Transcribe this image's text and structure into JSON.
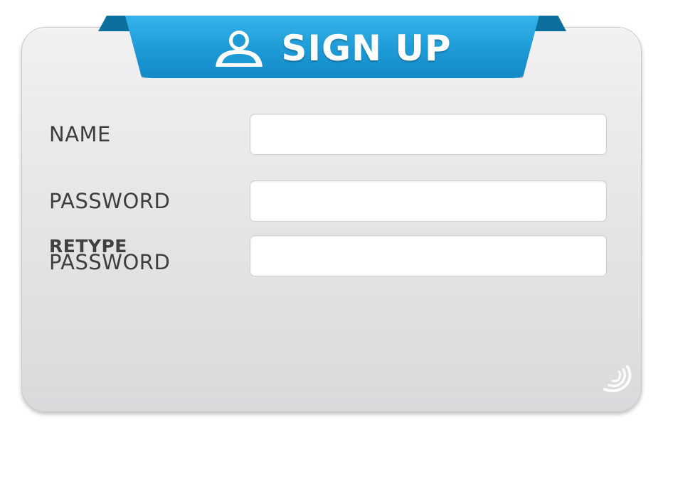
{
  "header": {
    "title": "SIGN UP",
    "icon": "user-icon",
    "color": "#1e9bd7"
  },
  "form": {
    "name_label": "NAME",
    "name_value": "",
    "password_label": "PASSWORD",
    "password_value": "",
    "retype_label_line1": "RETYPE",
    "retype_label_line2": "PASSWORD",
    "retype_value": ""
  },
  "decor": {
    "corner_icon": "swirl-icon"
  }
}
